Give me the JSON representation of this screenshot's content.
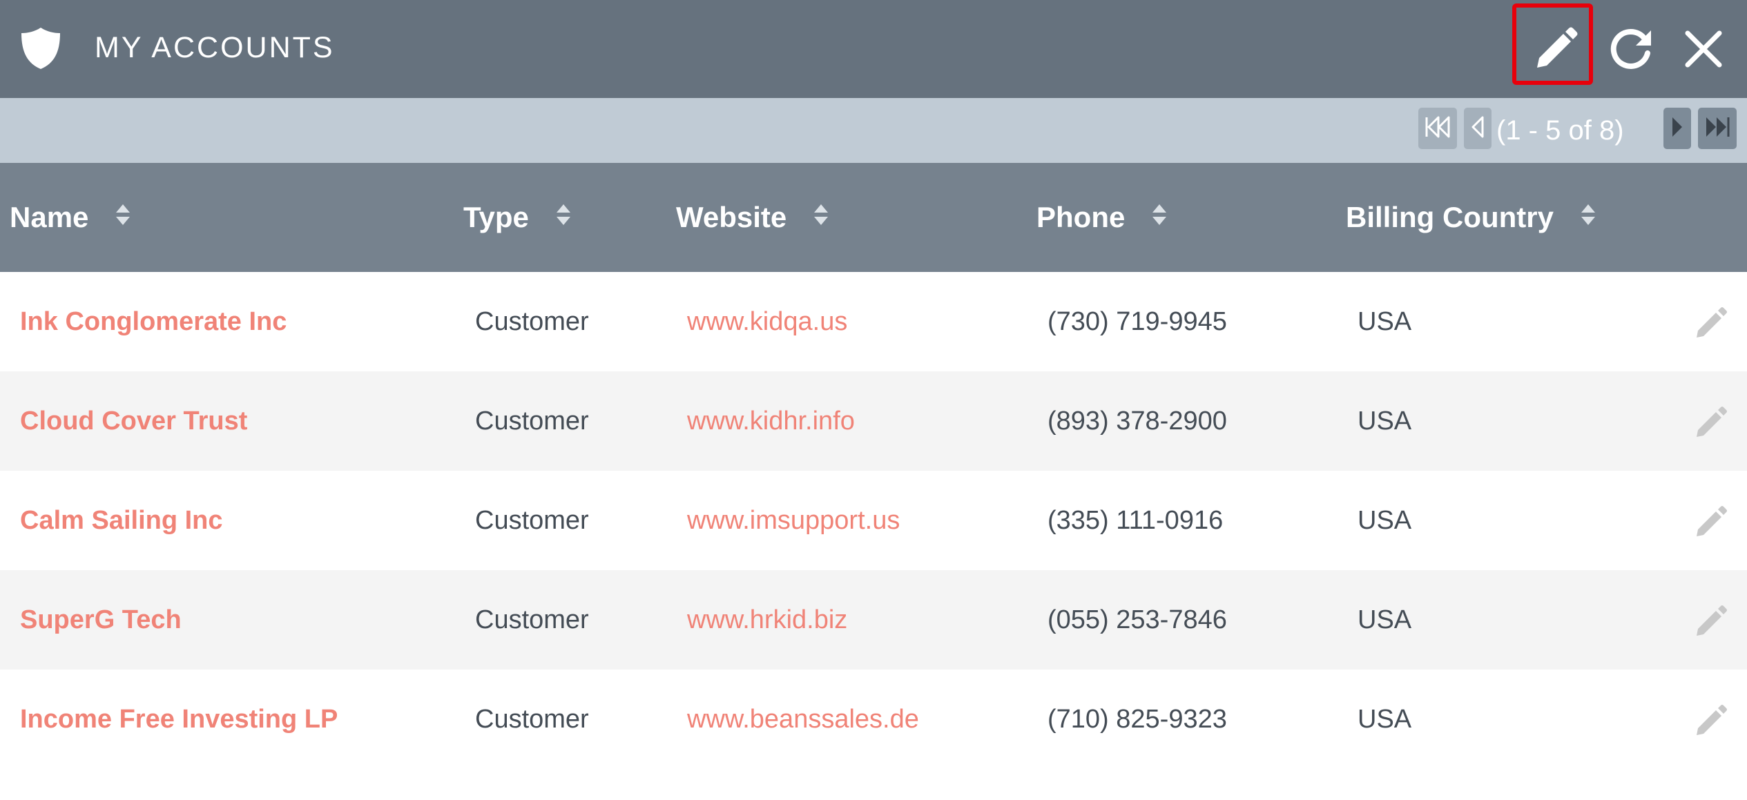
{
  "dashlet": {
    "title": "MY ACCOUNTS",
    "header_icons": [
      "shield-icon",
      "pencil-icon",
      "refresh-icon",
      "close-icon"
    ]
  },
  "pagination": {
    "summary": "(1 - 5 of 8)",
    "buttons": [
      "first-page-icon",
      "previous-page-icon",
      "next-page-icon",
      "last-page-icon"
    ]
  },
  "table": {
    "columns": [
      "Name",
      "Type",
      "Website",
      "Phone",
      "Billing Country"
    ],
    "rows": [
      {
        "name": "Ink Conglomerate Inc",
        "type": "Customer",
        "website": "www.kidqa.us",
        "phone": "(730) 719-9945",
        "country": "USA"
      },
      {
        "name": "Cloud Cover Trust",
        "type": "Customer",
        "website": "www.kidhr.info",
        "phone": "(893) 378-2900",
        "country": "USA"
      },
      {
        "name": "Calm Sailing Inc",
        "type": "Customer",
        "website": "www.imsupport.us",
        "phone": "(335) 111-0916",
        "country": "USA"
      },
      {
        "name": "SuperG Tech",
        "type": "Customer",
        "website": "www.hrkid.biz",
        "phone": "(055) 253-7846",
        "country": "USA"
      },
      {
        "name": "Income Free Investing LP",
        "type": "Customer",
        "website": "www.beanssales.de",
        "phone": "(710) 825-9323",
        "country": "USA"
      }
    ]
  },
  "colors": {
    "header_bg": "#66727e",
    "pager_bg": "#c0cbd5",
    "thead_bg": "#76828e",
    "link": "#f08377",
    "highlight_box": "#e8000b"
  }
}
